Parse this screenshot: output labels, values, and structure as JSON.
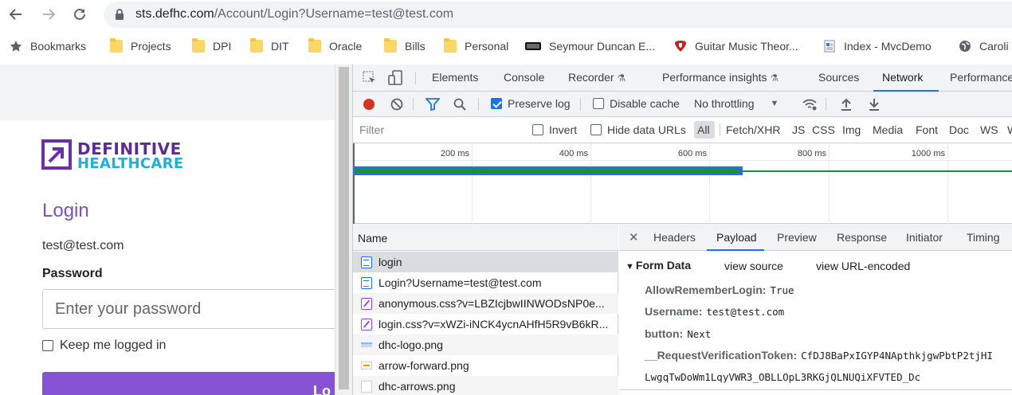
{
  "browser": {
    "url_host": "sts.defhc.com",
    "url_path": "/Account/Login?Username=test@test.com",
    "bookmarks": [
      {
        "label": "Bookmarks",
        "icon": "star-icon"
      },
      {
        "label": "Projects",
        "icon": "folder-icon"
      },
      {
        "label": "DPI",
        "icon": "folder-icon"
      },
      {
        "label": "DIT",
        "icon": "folder-icon"
      },
      {
        "label": "Oracle",
        "icon": "folder-icon"
      },
      {
        "label": "Bills",
        "icon": "folder-icon"
      },
      {
        "label": "Personal",
        "icon": "folder-icon"
      },
      {
        "label": "Seymour Duncan E...",
        "icon": "seymour-duncan-icon"
      },
      {
        "label": "Guitar Music Theor...",
        "icon": "guitar-pick-icon"
      },
      {
        "label": "Index - MvcDemo",
        "icon": "page-icon"
      },
      {
        "label": "Caroli",
        "icon": "globe-icon"
      }
    ]
  },
  "page": {
    "logo_line1": "DEFINITIVE",
    "logo_line2": "HEALTHCARE",
    "title": "Login",
    "username": "test@test.com",
    "password_label": "Password",
    "password_placeholder": "Enter your password",
    "keep_logged_in": "Keep me logged in",
    "login_button": "Lo",
    "colors": {
      "brand_purple": "#8553d3",
      "logo_teal": "#1fb0d6"
    }
  },
  "devtools": {
    "tabs": [
      "Elements",
      "Console",
      "Recorder",
      "Performance insights",
      "Sources",
      "Network",
      "Performance"
    ],
    "active_tab": "Network",
    "toolbar": {
      "preserve_log": "Preserve log",
      "preserve_log_checked": true,
      "disable_cache": "Disable cache",
      "disable_cache_checked": false,
      "throttling": "No throttling"
    },
    "filter": {
      "placeholder": "Filter",
      "invert": "Invert",
      "hide_data_urls": "Hide data URLs",
      "types": [
        "All",
        "Fetch/XHR",
        "JS",
        "CSS",
        "Img",
        "Media",
        "Font",
        "Doc",
        "WS",
        "W"
      ],
      "selected_type": "All"
    },
    "timeline": {
      "ticks": [
        "200 ms",
        "400 ms",
        "600 ms",
        "800 ms",
        "1000 ms"
      ]
    },
    "requests": {
      "column": "Name",
      "rows": [
        {
          "name": "login",
          "type": "doc"
        },
        {
          "name": "Login?Username=test@test.com",
          "type": "doc"
        },
        {
          "name": "anonymous.css?v=LBZIcjbwIINWODsNP0e...",
          "type": "css"
        },
        {
          "name": "login.css?v=xWZi-iNCK4ycnAHfH5R9vB6kR...",
          "type": "css"
        },
        {
          "name": "dhc-logo.png",
          "type": "img"
        },
        {
          "name": "arrow-forward.png",
          "type": "img"
        },
        {
          "name": "dhc-arrows.png",
          "type": "img"
        }
      ],
      "selected": "login"
    },
    "details": {
      "tabs": [
        "Headers",
        "Payload",
        "Preview",
        "Response",
        "Initiator",
        "Timing"
      ],
      "active_tab": "Payload",
      "section": "Form Data",
      "view_source": "view source",
      "view_url_encoded": "view URL-encoded",
      "fields": [
        {
          "key": "AllowRememberLogin:",
          "value": "True"
        },
        {
          "key": "Username:",
          "value": "test@test.com"
        },
        {
          "key": "button:",
          "value": "Next"
        },
        {
          "key": "__RequestVerificationToken:",
          "value": "CfDJ8BaPxIGYP4NApthkjgwPbtP2tjHI",
          "value_cont": "LwgqTwDoWm1LqyVWR3_OBLLOpL3RKGjQLNUQiXFVTED_Dc"
        }
      ]
    }
  }
}
